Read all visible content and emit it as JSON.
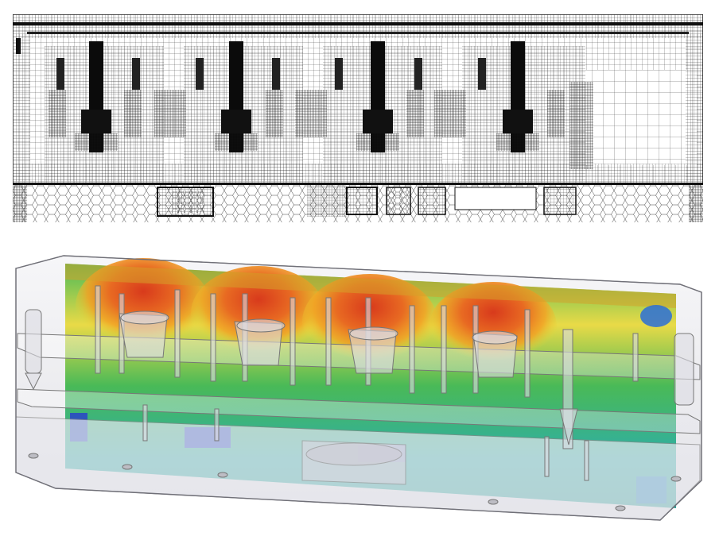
{
  "figure": {
    "panels": [
      {
        "id": "mesh",
        "kind": "computational-mesh-cross-section",
        "style": "black wireframe on white"
      },
      {
        "id": "cfd",
        "kind": "3d-translucent-enclosure-with-temperature-contour",
        "style": "rainbow colormap"
      }
    ],
    "colormap": {
      "hot": "#d83a1c",
      "warm": "#f2a224",
      "mid": "#e8d838",
      "cool": "#3bb54a",
      "cold": "#1fa9a0",
      "coldest": "#2a44c8"
    },
    "mesh_colors": {
      "line": "#1a1a1a",
      "background": "#ffffff"
    }
  }
}
